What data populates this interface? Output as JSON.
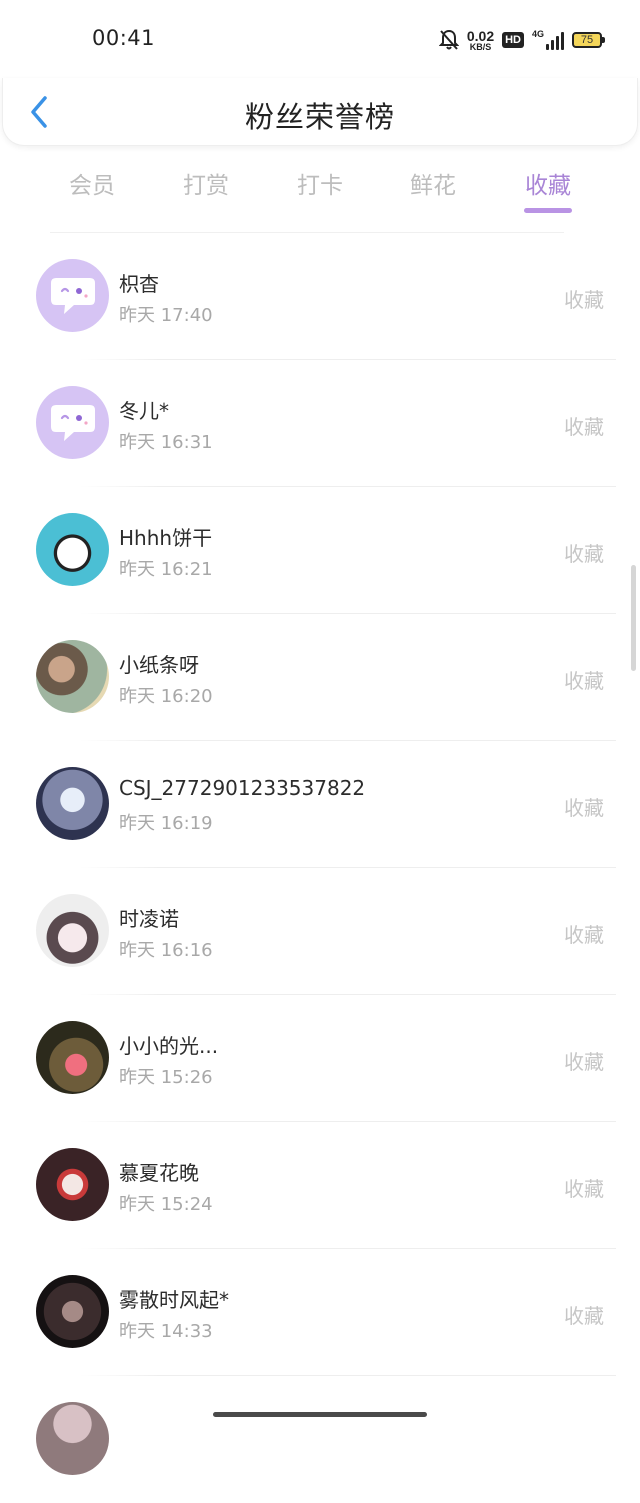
{
  "status_bar": {
    "time": "00:41",
    "net_speed": "0.02",
    "net_unit": "KB/S",
    "hd": "HD",
    "signal": "4G",
    "battery": "75",
    "icons": [
      "bell-off-icon",
      "hd-icon",
      "signal-icon",
      "battery-icon"
    ]
  },
  "header": {
    "title": "粉丝荣誉榜",
    "back_icon": "chevron-left-icon"
  },
  "tabs": [
    {
      "label": "会员",
      "active": false
    },
    {
      "label": "打赏",
      "active": false
    },
    {
      "label": "打卡",
      "active": false
    },
    {
      "label": "鲜花",
      "active": false
    },
    {
      "label": "收藏",
      "active": true
    }
  ],
  "colors": {
    "accent": "#a985d6",
    "indicator": "#b993e4",
    "placeholder_avatar": "#d6c4f4"
  },
  "list": [
    {
      "name": "枳杳",
      "time": "昨天 17:40",
      "action": "收藏",
      "avatar": "placeholder"
    },
    {
      "name": "冬儿*",
      "time": "昨天 16:31",
      "action": "收藏",
      "avatar": "placeholder"
    },
    {
      "name": "Hhhh饼干",
      "time": "昨天 16:21",
      "action": "收藏",
      "avatar": "photo"
    },
    {
      "name": "小纸条呀",
      "time": "昨天 16:20",
      "action": "收藏",
      "avatar": "photo"
    },
    {
      "name": "CSJ_2772901233537822",
      "time": "昨天 16:19",
      "action": "收藏",
      "avatar": "photo"
    },
    {
      "name": "时凌诺",
      "time": "昨天 16:16",
      "action": "收藏",
      "avatar": "photo"
    },
    {
      "name": "小小的光...",
      "time": "昨天 15:26",
      "action": "收藏",
      "avatar": "photo"
    },
    {
      "name": "慕夏花晚",
      "time": "昨天 15:24",
      "action": "收藏",
      "avatar": "photo"
    },
    {
      "name": "雾散时风起*",
      "time": "昨天 14:33",
      "action": "收藏",
      "avatar": "photo"
    }
  ]
}
